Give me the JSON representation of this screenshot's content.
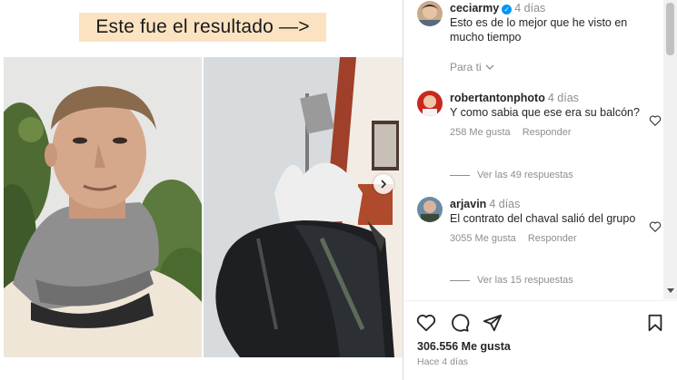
{
  "media": {
    "caption": "Este fue el resultado —>"
  },
  "post": {
    "author": "ceciarmy",
    "author_time": "4 días",
    "caption": "Esto es de lo mejor que he visto en mucho tiempo",
    "filter_label": "Para ti"
  },
  "comments": [
    {
      "user": "robertantonphoto",
      "time": "4 días",
      "text": "Y como sabia que ese era su balcón?",
      "likes": "258 Me gusta",
      "reply_label": "Responder",
      "replies": "Ver las 49 respuestas"
    },
    {
      "user": "arjavin",
      "time": "4 días",
      "text": "El contrato del chaval salió del grupo",
      "likes": "3055 Me gusta",
      "reply_label": "Responder",
      "replies": "Ver las 15 respuestas"
    }
  ],
  "actions": {
    "icons": [
      "heart-icon",
      "comment-icon",
      "share-icon",
      "bookmark-icon"
    ],
    "likes": "306.556 Me gusta",
    "time_ago": "Hace 4 días"
  },
  "colors": {
    "caption_bg": "#fbe3c2",
    "verified": "#0095f6",
    "muted_text": "#8e8e8e"
  }
}
